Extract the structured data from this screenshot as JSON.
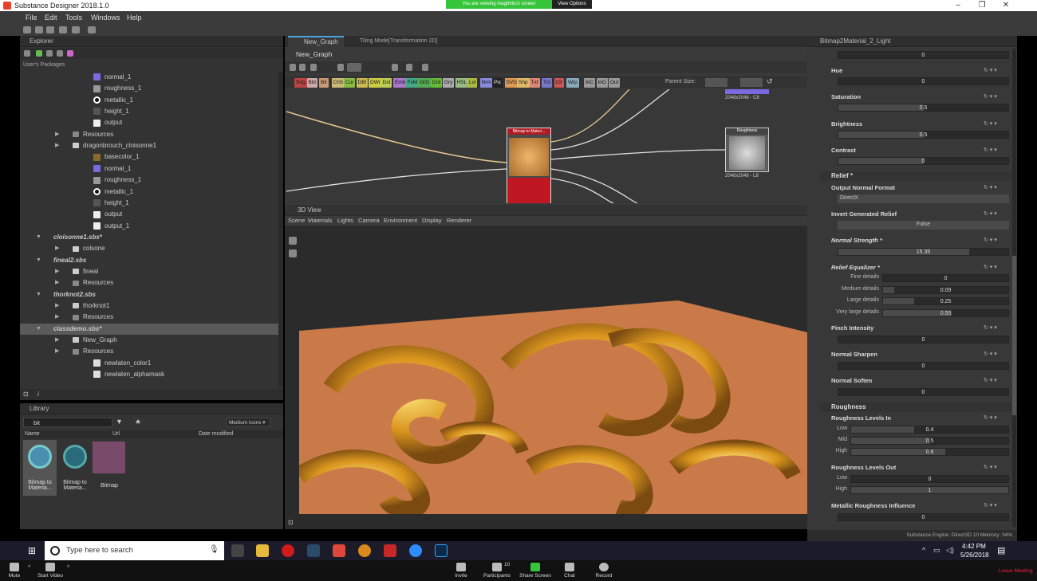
{
  "window": {
    "title": "Substance Designer 2018.1.0"
  },
  "screen_share": {
    "banner": "You are viewing magbhiiu's screen",
    "view_options": "View Options"
  },
  "menu": [
    "File",
    "Edit",
    "Tools",
    "Windows",
    "Help"
  ],
  "explorer": {
    "title": "Explorer",
    "section": "User's Packages",
    "rows": [
      {
        "label": "normal_1",
        "indent": 80,
        "icon": "normal-map-icon",
        "color": "#7a6ae0"
      },
      {
        "label": "roughness_1",
        "indent": 80,
        "icon": "grayscale-icon",
        "color": "#999"
      },
      {
        "label": "metallic_1",
        "indent": 80,
        "icon": "circle-icon",
        "color": "#fff"
      },
      {
        "label": "height_1",
        "indent": 80,
        "icon": "grayscale-icon",
        "color": "#555"
      },
      {
        "label": "output",
        "indent": 80,
        "icon": "output-icon",
        "color": "#eee"
      },
      {
        "label": "Resources",
        "indent": 54,
        "icon": "folder-icon",
        "color": "#888"
      },
      {
        "label": "dragonbrouch_cloisonne1",
        "indent": 54,
        "icon": "graph-icon",
        "color": "#ccc"
      },
      {
        "label": "basecolor_1",
        "indent": 80,
        "icon": "color-icon",
        "color": "#8a6a2a"
      },
      {
        "label": "normal_1",
        "indent": 80,
        "icon": "normal-map-icon",
        "color": "#7a6ae0"
      },
      {
        "label": "roughness_1",
        "indent": 80,
        "icon": "grayscale-icon",
        "color": "#999"
      },
      {
        "label": "metallic_1",
        "indent": 80,
        "icon": "circle-icon",
        "color": "#fff"
      },
      {
        "label": "height_1",
        "indent": 80,
        "icon": "grayscale-icon",
        "color": "#555"
      },
      {
        "label": "output",
        "indent": 80,
        "icon": "output-icon",
        "color": "#eee"
      },
      {
        "label": "output_1",
        "indent": 80,
        "icon": "output-icon",
        "color": "#eee"
      },
      {
        "label": "cloisonne1.sbs*",
        "indent": 30,
        "icon": "",
        "color": "",
        "bold": true
      },
      {
        "label": "colsone",
        "indent": 54,
        "icon": "graph-icon",
        "color": "#ccc"
      },
      {
        "label": "fineal2.sbs",
        "indent": 30,
        "icon": "",
        "color": "",
        "bold": true
      },
      {
        "label": "fineal",
        "indent": 54,
        "icon": "graph-icon",
        "color": "#ccc"
      },
      {
        "label": "Resources",
        "indent": 54,
        "icon": "folder-icon",
        "color": "#888"
      },
      {
        "label": "thorknot2.sbs",
        "indent": 30,
        "icon": "",
        "color": "",
        "bold": true
      },
      {
        "label": "thorknot1",
        "indent": 54,
        "icon": "graph-icon",
        "color": "#ccc"
      },
      {
        "label": "Resources",
        "indent": 54,
        "icon": "folder-icon",
        "color": "#888"
      },
      {
        "label": "classdemo.sbs*",
        "indent": 30,
        "icon": "",
        "color": "",
        "bold": true,
        "selected": true
      },
      {
        "label": "New_Graph",
        "indent": 54,
        "icon": "graph-icon",
        "color": "#ccc"
      },
      {
        "label": "Resources",
        "indent": 54,
        "icon": "folder-icon",
        "color": "#888"
      },
      {
        "label": "newlaten_color1",
        "indent": 80,
        "icon": "bitmap-icon",
        "color": "#ddd"
      },
      {
        "label": "newlaten_alphamask",
        "indent": 80,
        "icon": "bitmap-icon",
        "color": "#ddd"
      }
    ]
  },
  "library": {
    "title": "Library",
    "search_value": "bit",
    "view_mode": "Medium Icons",
    "columns": [
      "Name",
      "Url",
      "Date modified"
    ],
    "items": [
      {
        "label": "Bitmap to Materia...",
        "icon": "substance-gear-icon"
      },
      {
        "label": "Bitmap to Materia...",
        "icon": "substance-gear-icon"
      },
      {
        "label": "Bitmap",
        "icon": "bitmap-swatch-icon"
      }
    ]
  },
  "graph": {
    "tabs": [
      "New_Graph",
      "Tiling Mode[Transformation 2D]"
    ],
    "panel_title": "New_Graph",
    "filters": [
      {
        "label": "Sng",
        "color": "#b44"
      },
      {
        "label": "Bld",
        "color": "#caa"
      },
      {
        "label": "Blr",
        "color": "#c97"
      },
      {
        "label": "ChS",
        "color": "#cb7"
      },
      {
        "label": "Cur",
        "color": "#8b4"
      },
      {
        "label": "DBl",
        "color": "#cb5"
      },
      {
        "label": "DWr",
        "color": "#cc4"
      },
      {
        "label": "Dst",
        "color": "#bc5"
      },
      {
        "label": "Emb",
        "color": "#a7c"
      },
      {
        "label": "FxM",
        "color": "#4a8"
      },
      {
        "label": "GrD",
        "color": "#5a5"
      },
      {
        "label": "Grd",
        "color": "#6b3"
      },
      {
        "label": "Gry",
        "color": "#aaa"
      },
      {
        "label": "HSL",
        "color": "#9b8"
      },
      {
        "label": "Lvl",
        "color": "#ab4"
      },
      {
        "label": "Nrm",
        "color": "#88d"
      },
      {
        "label": "Pix",
        "color": "#222"
      },
      {
        "label": "SVG",
        "color": "#d95"
      },
      {
        "label": "Shp",
        "color": "#db6"
      },
      {
        "label": "Txt",
        "color": "#d87"
      },
      {
        "label": "Trs",
        "color": "#77c"
      },
      {
        "label": "Clr",
        "color": "#c55"
      },
      {
        "label": "Wrp",
        "color": "#8ab"
      },
      {
        "label": "InC",
        "color": "#999"
      },
      {
        "label": "InG",
        "color": "#999"
      },
      {
        "label": "Out",
        "color": "#999"
      }
    ],
    "parent_size_label": "Parent Size:",
    "node_main": {
      "title": "Bitmap to Materi..."
    },
    "node_roughness": {
      "title": "Roughness",
      "size": "2048x2048 - L8"
    },
    "node_top_size": "2048x2048 - C8"
  },
  "view3d": {
    "title": "3D View",
    "menu": [
      "Scene",
      "Materials",
      "Lights",
      "Camera",
      "Environment",
      "Display",
      "Renderer"
    ]
  },
  "properties": {
    "title": "Bitmap2Material_2_Light",
    "top_value": "0",
    "rows": [
      {
        "label": "Hue",
        "value": "0",
        "fill": 0
      },
      {
        "label": "Saturation",
        "value": "0.5",
        "fill": 0.5
      },
      {
        "label": "Brightness",
        "value": "0.5",
        "fill": 0.5
      },
      {
        "label": "Contrast",
        "value": "0",
        "fill": 0.5
      }
    ],
    "relief": {
      "header": "Relief *",
      "output_normal_format": {
        "label": "Output Normal Format",
        "value": "DirectX"
      },
      "invert_generated_relief": {
        "label": "Invert Generated Relief",
        "value": "False"
      },
      "normal_strength": {
        "label": "Normal Strength *",
        "value": "15.35",
        "fill": 0.77
      },
      "relief_equalizer": {
        "label": "Relief Equalizer *",
        "subs": [
          {
            "label": "Fine details",
            "value": "0",
            "fill": 0
          },
          {
            "label": "Medium details",
            "value": "0.09",
            "fill": 0.09
          },
          {
            "label": "Large details",
            "value": "0.25",
            "fill": 0.25
          },
          {
            "label": "Very large details",
            "value": "0.55",
            "fill": 0.55
          }
        ]
      },
      "pinch_intensity": {
        "label": "Pinch Intensity",
        "value": "0"
      },
      "normal_sharpen": {
        "label": "Normal Sharpen",
        "value": "0"
      },
      "normal_soften": {
        "label": "Normal Soften",
        "value": "0"
      }
    },
    "roughness": {
      "header": "Roughness",
      "levels_in": {
        "label": "Roughness Levels In",
        "subs": [
          {
            "label": "Low",
            "value": "0.4",
            "fill": 0.4
          },
          {
            "label": "Mid",
            "value": "0.5",
            "fill": 0.5
          },
          {
            "label": "High",
            "value": "0.6",
            "fill": 0.6
          }
        ]
      },
      "levels_out": {
        "label": "Roughness Levels Out",
        "subs": [
          {
            "label": "Low",
            "value": "0",
            "fill": 0
          },
          {
            "label": "High",
            "value": "1",
            "fill": 1
          }
        ]
      },
      "metallic_influence": {
        "label": "Metallic Roughness Influence",
        "value": "0"
      }
    },
    "status": "Substance Engine: Direct3D 10  Memory: 34%"
  },
  "taskbar": {
    "search_placeholder": "Type here to search",
    "time": "4:42 PM",
    "date": "5/26/2018"
  },
  "zoom": {
    "mute": "Mute",
    "start_video": "Start Video",
    "invite": "Invite",
    "participants": "Participants",
    "participants_count": "10",
    "share_screen": "Share Screen",
    "chat": "Chat",
    "record": "Record",
    "leave": "Leave Meeting"
  }
}
